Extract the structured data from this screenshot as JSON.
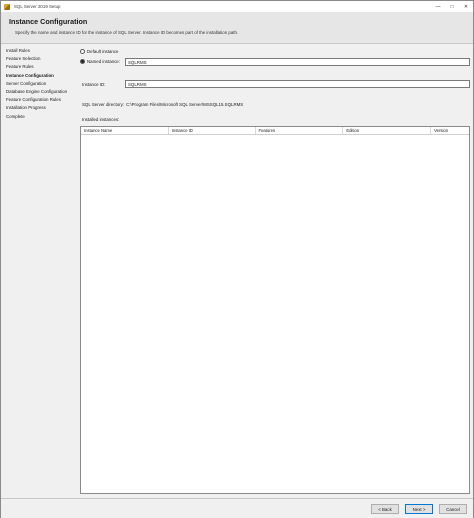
{
  "window": {
    "title": "SQL Server 2019 Setup",
    "minimize_glyph": "—",
    "maximize_glyph": "□",
    "close_glyph": "✕"
  },
  "header": {
    "title": "Instance Configuration",
    "description": "Specify the name and instance ID for the instance of SQL Server. Instance ID becomes part of the installation path."
  },
  "sidebar": {
    "items": [
      {
        "label": "Install Rules",
        "active": false
      },
      {
        "label": "Feature Selection",
        "active": false
      },
      {
        "label": "Feature Rules",
        "active": false
      },
      {
        "label": "Instance Configuration",
        "active": true
      },
      {
        "label": "Server Configuration",
        "active": false
      },
      {
        "label": "Database Engine Configuration",
        "active": false
      },
      {
        "label": "Feature Configuration Rules",
        "active": false
      },
      {
        "label": "Installation Progress",
        "active": false
      },
      {
        "label": "Complete",
        "active": false
      }
    ]
  },
  "form": {
    "default_instance_label": "Default instance",
    "named_instance_label": "Named instance:",
    "named_instance_value": "SQLRMS",
    "instance_id_label": "Instance ID:",
    "instance_id_value": "SQLRMS",
    "directory_label": "SQL Server directory:",
    "directory_value": "C:\\Program Files\\Microsoft SQL Server\\MSSQL15.SQLRMS",
    "installed_instances_label": "Installed instances:"
  },
  "table": {
    "columns": [
      "Instance Name",
      "Instance ID",
      "Features",
      "Edition",
      "Version"
    ]
  },
  "footer": {
    "back_label": "< Back",
    "next_label": "Next >",
    "cancel_label": "Cancel"
  }
}
